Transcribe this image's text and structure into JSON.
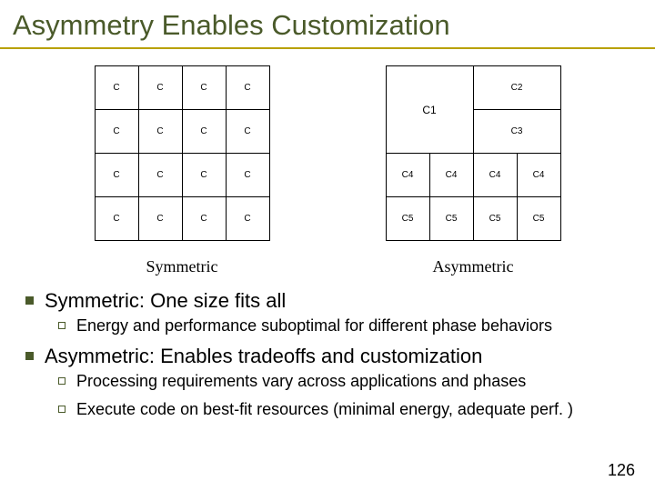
{
  "title": "Asymmetry Enables Customization",
  "symmetric": {
    "cell": "C",
    "caption": "Symmetric"
  },
  "asymmetric": {
    "c1": "C1",
    "c2": "C2",
    "c3": "C3",
    "c4": "C4",
    "c5": "C5",
    "caption": "Asymmetric"
  },
  "bullets": {
    "sym_head": "Symmetric: One size fits all",
    "sym_sub1": "Energy and performance suboptimal for different phase behaviors",
    "asym_head": "Asymmetric: Enables tradeoffs and customization",
    "asym_sub1": "Processing requirements vary across applications and phases",
    "asym_sub2": "Execute code on best-fit resources (minimal energy, adequate perf. )"
  },
  "page_number": "126"
}
